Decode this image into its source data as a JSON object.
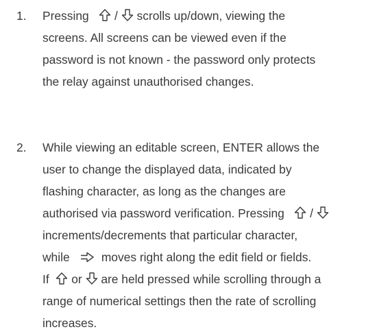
{
  "items": [
    {
      "number": "1.",
      "lines": [
        {
          "t1": "Pressing",
          "sep": "/",
          "t2": "scrolls up/down, viewing the"
        },
        {
          "text": "screens. All screens can be viewed even if the"
        },
        {
          "text": "password is not known - the password only protects"
        },
        {
          "text": "the relay against unauthorised changes."
        }
      ]
    },
    {
      "number": "2.",
      "lines": [
        {
          "text": "While viewing an editable screen, ENTER allows the"
        },
        {
          "text": "user to change the displayed data, indicated by"
        },
        {
          "text": "flashing character, as long as the changes are"
        },
        {
          "t1": "authorised via password verification. Pressing",
          "sep": "/"
        },
        {
          "text": "increments/decrements that particular character,"
        },
        {
          "t1": "while",
          "t2": "moves right along the edit field or fields."
        },
        {
          "t1": "If",
          "t2": "or",
          "t3": "are held pressed while scrolling through a"
        },
        {
          "text": "range of numerical settings then the rate of scrolling"
        },
        {
          "text": "increases."
        }
      ]
    }
  ],
  "icons": {
    "up": "up-arrow-icon",
    "down": "down-arrow-icon",
    "right": "right-arrow-icon"
  }
}
